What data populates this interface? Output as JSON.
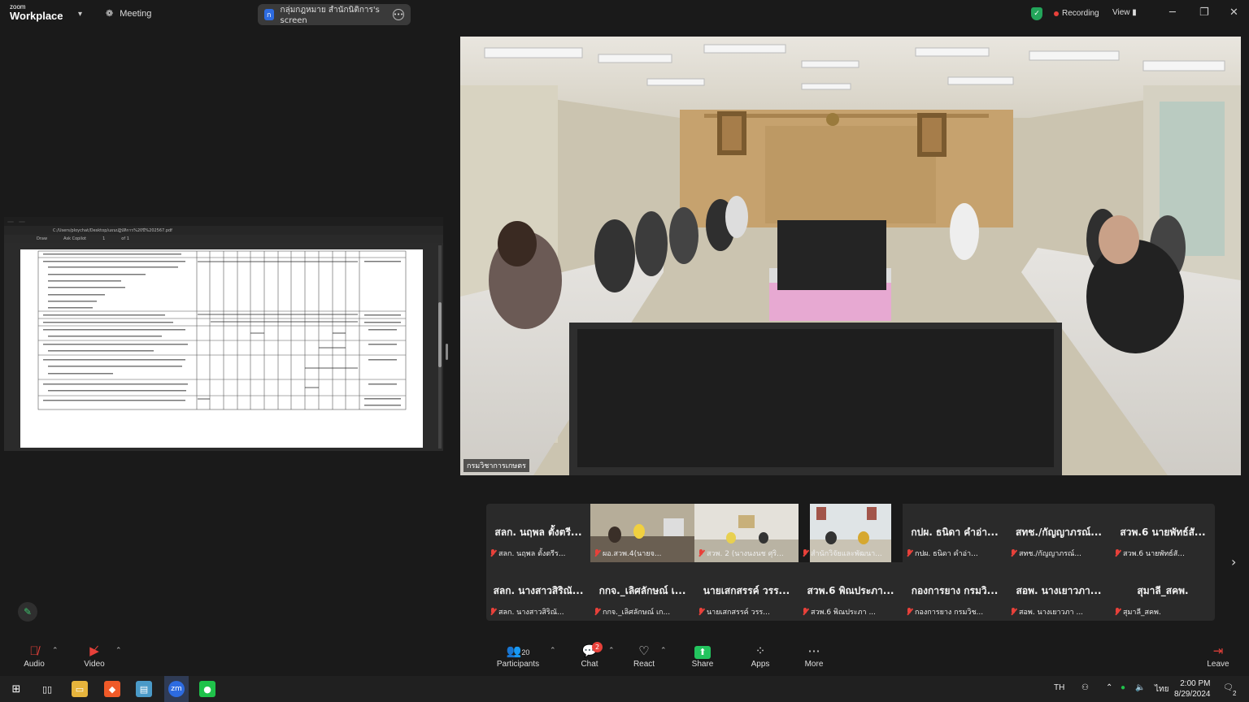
{
  "app": {
    "brand_small": "zoom",
    "brand_big": "Workplace"
  },
  "topbar": {
    "meeting_label": "Meeting",
    "screen_share_badge": "ก",
    "screen_share_label": "กลุ่มกฎหมาย สำนักนิติการ's screen",
    "recording_label": "Recording",
    "view_label": "View",
    "security_color": "#23a55a",
    "recording_color": "#e8413a"
  },
  "shared_screen": {
    "browser_tabs": [
      "",
      ""
    ],
    "address": "C:/Users/ploychat/Desktop/แผนปฏิบัติการ%20ปี%202567.pdf",
    "tools": [
      "Draw",
      "Ask Copilot",
      "1",
      "of 1"
    ]
  },
  "main_video": {
    "participant_label": "กรมวิชาการเกษตร"
  },
  "gallery": {
    "tiles": [
      {
        "big": "สลก. นฤพล ตั้งตรี...",
        "small": "สลก. นฤพล ตั้งตรีร..."
      },
      {
        "big": "",
        "small": "ผอ.สวพ.4(นายจ..."
      },
      {
        "big": "",
        "small": "สวพ. 2 (นางนงนช ศุริ..."
      },
      {
        "big": "",
        "small": "สำนักวิจัยและพัฒนา..."
      },
      {
        "big": "กปผ. ธนิดา คำอ่า...",
        "small": "กปผ. ธนิดา คำอ่า..."
      },
      {
        "big": "สทช./กัญญาภรณ์...",
        "small": "สทช./กัญญาภรณ์..."
      },
      {
        "big": "สวพ.6 นายพัทธ์สั...",
        "small": "สวพ.6 นายพัทธ์สั..."
      },
      {
        "big": "สลก. นางสาวสิริณั...",
        "small": "สลก. นางสาวสิริณั..."
      },
      {
        "big": "กกจ._เลิศลักษณ์ เ...",
        "small": "กกจ._เลิศลักษณ์ เก..."
      },
      {
        "big": "นายเสกสรรค์ วรร...",
        "small": "นายเสกสรรค์ วรร..."
      },
      {
        "big": "สวพ.6 พิณประภา...",
        "small": "สวพ.6 พิณประภา ..."
      },
      {
        "big": "กองการยาง กรมวิ...",
        "small": "กองการยาง กรมวิช..."
      },
      {
        "big": "สอพ. นางเยาวภา...",
        "small": "สอพ. นางเยาวภา ..."
      },
      {
        "big": "สุมาลี_สคพ.",
        "small": "สุมาลี_สคพ."
      }
    ]
  },
  "controls": {
    "audio": "Audio",
    "video": "Video",
    "participants": "Participants",
    "participants_count": "20",
    "chat": "Chat",
    "chat_badge": "2",
    "react": "React",
    "share": "Share",
    "apps": "Apps",
    "more": "More",
    "leave": "Leave",
    "share_color": "#23c45e"
  },
  "taskbar": {
    "lang": "TH",
    "ime": "ไทย",
    "time": "2:00 PM",
    "date": "8/29/2024",
    "notif_count": "2"
  }
}
